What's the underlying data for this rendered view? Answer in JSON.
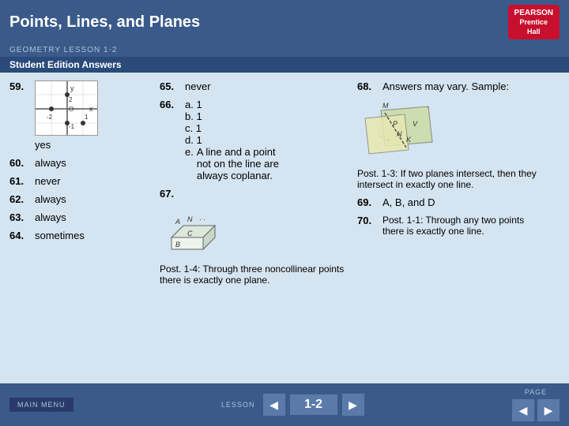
{
  "header": {
    "title": "Points, Lines, and Planes",
    "subtitle": "GEOMETRY LESSON 1-2",
    "section": "Student Edition Answers",
    "logo_line1": "PEARSON",
    "logo_line2": "Prentice",
    "logo_line3": "Hall"
  },
  "answers": {
    "q59": {
      "num": "59.",
      "label": "yes"
    },
    "q60": {
      "num": "60.",
      "text": "always"
    },
    "q61": {
      "num": "61.",
      "text": "never"
    },
    "q62": {
      "num": "62.",
      "text": "always"
    },
    "q63": {
      "num": "63.",
      "text": "always"
    },
    "q64": {
      "num": "64.",
      "text": "sometimes"
    },
    "q65": {
      "num": "65.",
      "text": "never"
    },
    "q66": {
      "num": "66.",
      "a": "a. 1",
      "b": "b. 1",
      "c": "c. 1",
      "d": "d. 1",
      "e_prefix": "e.",
      "e_text": "A line and a point",
      "e_cont": "not on the line are",
      "e_cont2": "always coplanar."
    },
    "q67": {
      "num": "67.",
      "caption": "Post. 1-4: Through three noncollinear points there is exactly one plane."
    },
    "q68": {
      "num": "68.",
      "text": "Answers may vary. Sample:",
      "caption": "Post. 1-3: If two planes intersect, then they intersect in exactly one line."
    },
    "q69": {
      "num": "69.",
      "text": "A, B, and D"
    },
    "q70": {
      "num": "70.",
      "text": "Post. 1-1: Through any two points there is exactly one line."
    }
  },
  "footer": {
    "main_menu": "MAIN MENU",
    "lesson": "LESSON",
    "page": "PAGE",
    "lesson_num": "1-2"
  }
}
